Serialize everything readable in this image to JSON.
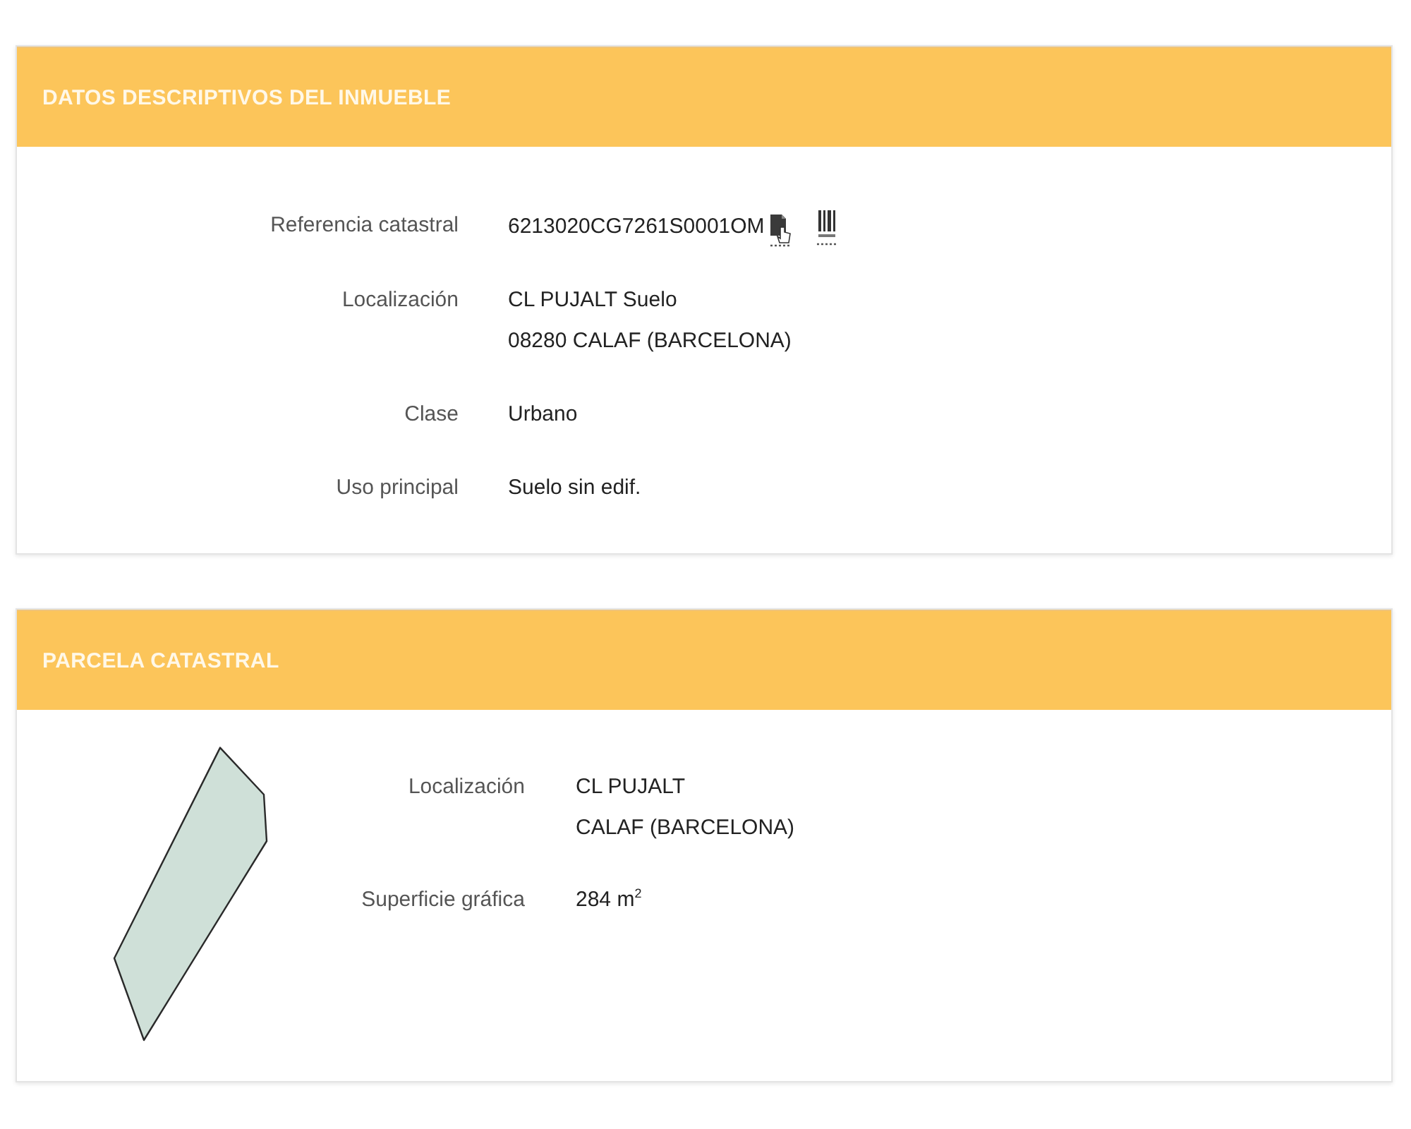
{
  "sections": [
    {
      "kind": "details",
      "title": "DATOS DESCRIPTIVOS DEL INMUEBLE",
      "fields": [
        {
          "kind": "reference",
          "label": "Referencia catastral",
          "lines": [
            "6213020CG7261S0001OM"
          ]
        },
        {
          "kind": "text",
          "label": "Localización",
          "lines": [
            "CL PUJALT Suelo",
            "08280 CALAF (BARCELONA)"
          ]
        },
        {
          "kind": "text",
          "label": "Clase",
          "lines": [
            "Urbano"
          ]
        },
        {
          "kind": "text",
          "label": "Uso principal",
          "lines": [
            "Suelo sin edif."
          ]
        }
      ]
    },
    {
      "kind": "parcel",
      "title": "PARCELA CATASTRAL",
      "fields": [
        {
          "kind": "text",
          "label": "Localización",
          "lines": [
            "CL PUJALT",
            "CALAF (BARCELONA)"
          ]
        },
        {
          "kind": "text",
          "label": "Superficie gráfica",
          "lines": [
            "284 m$^{2}$"
          ]
        }
      ]
    }
  ]
}
